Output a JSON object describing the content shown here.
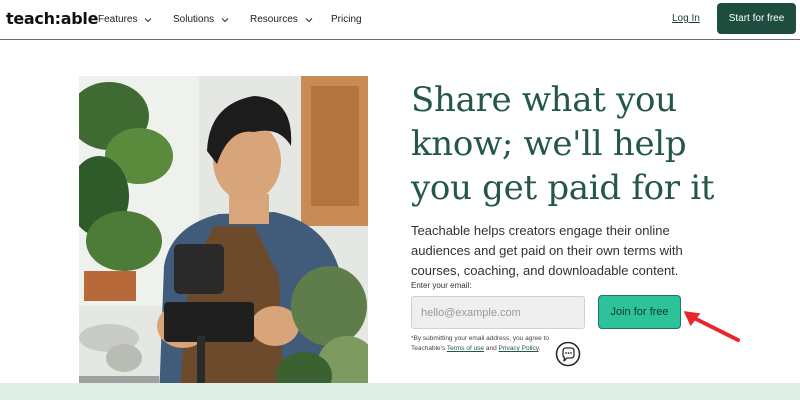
{
  "header": {
    "logo": "teach:able",
    "nav": [
      {
        "label": "Features",
        "has_dropdown": true
      },
      {
        "label": "Solutions",
        "has_dropdown": true
      },
      {
        "label": "Resources",
        "has_dropdown": true
      },
      {
        "label": "Pricing",
        "has_dropdown": false
      }
    ],
    "login_label": "Log In",
    "cta_label": "Start for free"
  },
  "hero": {
    "headline_lines": [
      "Share what you",
      "know; we'll help",
      "you get paid for it"
    ],
    "subtext_lines": [
      "Teachable helps creators engage their online",
      "audiences and get paid on their own terms with",
      "courses, coaching, and downloadable content."
    ],
    "email_label": "Enter your email:",
    "email_placeholder": "hello@example.com",
    "email_value": "",
    "join_label": "Join for free",
    "disclaimer_prefix": "*By submitting your email address, you agree to",
    "disclaimer_brand": "Teachable's",
    "terms_label": "Terms of use",
    "and_text": "and",
    "privacy_label": "Privacy Policy",
    "disclaimer_suffix": "."
  },
  "icons": {
    "chat": "chat-bubble-icon",
    "annotation_arrow": "red-arrow-icon",
    "dropdown": "chevron-down-icon"
  },
  "colors": {
    "brand_dark": "#1e4d40",
    "headline": "#24574a",
    "join_button": "#2ec29a",
    "arrow": "#e8262c",
    "bottom_band": "#dfeee6"
  }
}
